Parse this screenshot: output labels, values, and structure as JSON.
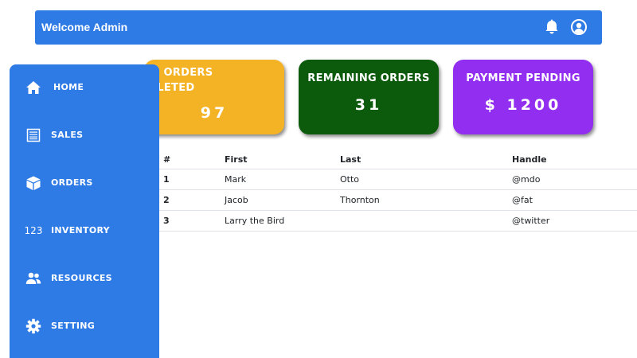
{
  "header": {
    "title": "Welcome Admin",
    "icons": [
      "bell-icon",
      "user-circle-icon"
    ]
  },
  "sidebar": {
    "items": [
      {
        "label": "HOME",
        "icon": "home-icon"
      },
      {
        "label": "SALES",
        "icon": "receipt-icon"
      },
      {
        "label": "ORDERS",
        "icon": "box-icon"
      },
      {
        "label": "INVENTORY",
        "icon": "numbers-icon",
        "icon_text": "123"
      },
      {
        "label": "RESOURCES",
        "icon": "people-icon"
      },
      {
        "label": "SETTING",
        "icon": "gear-icon"
      }
    ]
  },
  "cards": [
    {
      "title": "TOTAL ORDERS COMPLETED",
      "value": "97",
      "color": "#f4b325"
    },
    {
      "title": "REMAINING ORDERS",
      "value": "31",
      "color": "#0c5a0b"
    },
    {
      "title": "PAYMENT PENDING",
      "value": "$ 1200",
      "color": "#922ef0"
    }
  ],
  "table": {
    "headers": [
      "#",
      "First",
      "Last",
      "Handle"
    ],
    "rows": [
      [
        "1",
        "Mark",
        "Otto",
        "@mdo"
      ],
      [
        "2",
        "Jacob",
        "Thornton",
        "@fat"
      ],
      [
        "3",
        "Larry the Bird",
        "",
        "@twitter"
      ]
    ]
  },
  "colors": {
    "primary": "#2f7be6",
    "text": "#212529",
    "divider": "#dee2e6"
  }
}
